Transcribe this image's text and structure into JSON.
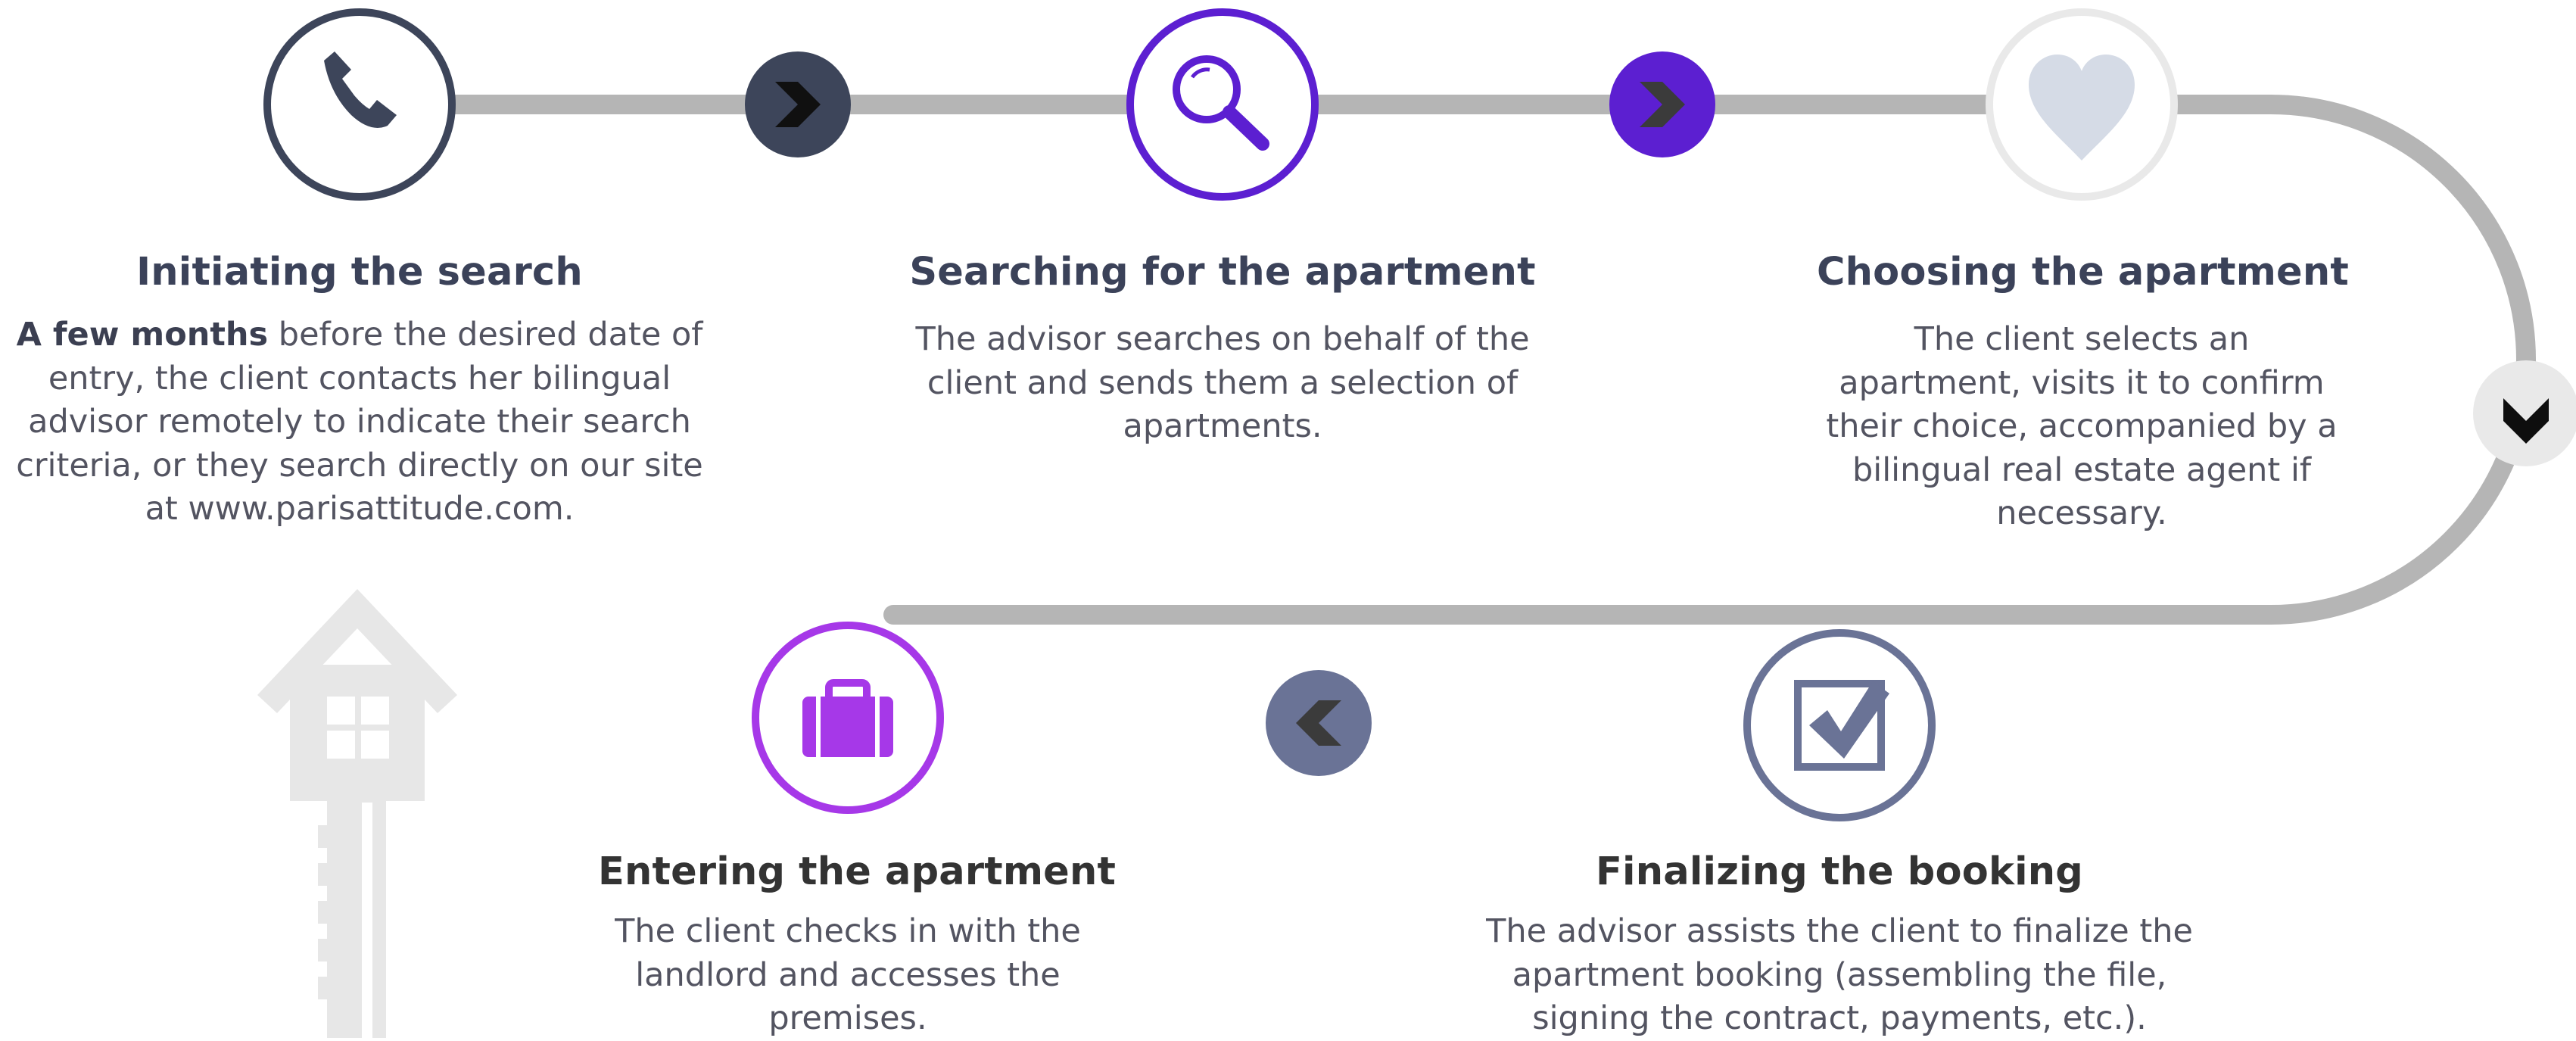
{
  "colors": {
    "path": "#b5b5b5",
    "dark_navy": "#3d455a",
    "purple": "#5c1fd1",
    "light_gray": "#e9e9e9",
    "heart": "#d5dbe6",
    "slate": "#6a7396",
    "magenta": "#a638e8",
    "key": "#e7e7e7",
    "title_navy": "#3b4259",
    "title_dark": "#333333",
    "text": "#535461"
  },
  "steps": [
    {
      "icon": "phone-icon",
      "title": "Initiating the search",
      "desc_bold": "A few months",
      "desc_rest": " before the desired date of entry, the client contacts her bilingual advisor remotely to indicate their search criteria, or they search directly on our site at www.parisattitude.com."
    },
    {
      "icon": "magnifier-icon",
      "title": "Searching for the apartment",
      "desc": "The advisor searches on behalf of the client and sends them a selection of apartments."
    },
    {
      "icon": "heart-icon",
      "title": "Choosing the apartment",
      "desc": "The client selects an apartment, visits it to confirm their choice, accompanied by a bilingual real estate agent if necessary."
    },
    {
      "icon": "checkbox-icon",
      "title": "Finalizing the booking",
      "desc": "The advisor assists the client to finalize the apartment booking (assembling the file, signing the contract, payments, etc.)."
    },
    {
      "icon": "suitcase-icon",
      "title": "Entering the apartment",
      "desc": "The client checks in with the landlord and accesses the premises."
    }
  ],
  "connectors": [
    "chevron-right-icon",
    "chevron-right-icon",
    "chevron-down-icon",
    "chevron-left-icon"
  ],
  "decoration": "house-key-icon"
}
